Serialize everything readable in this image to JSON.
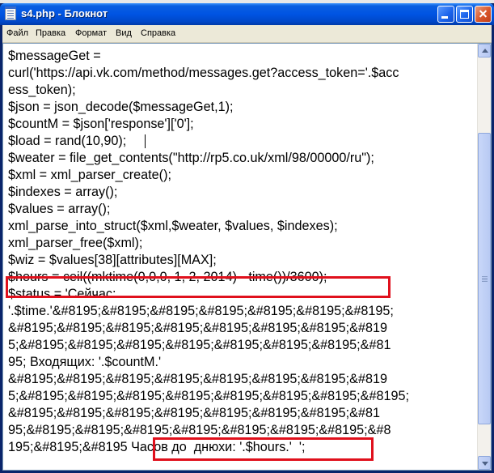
{
  "window": {
    "title": "s4.php - Блокнот"
  },
  "menu": [
    "Файл",
    "Правка",
    "Формат",
    "Вид",
    "Справка"
  ],
  "icons": {
    "app": "notepad-icon",
    "minimize": "minimize-icon",
    "maximize": "maximize-icon",
    "close": "close-icon",
    "scroll_up": "arrow-up-icon",
    "scroll_down": "arrow-down-icon"
  },
  "colors": {
    "highlight": "#e0101c",
    "titlebar": "#0054e3"
  },
  "editor": {
    "lines": [
      "$messageGet =",
      "curl('https://api.vk.com/method/messages.get?access_token='.$acc",
      "ess_token);",
      "$json = json_decode($messageGet,1);",
      "$countM = $json['response']['0'];",
      "$load = rand(10,90);",
      "$weater = file_get_contents(\"http://rp5.co.uk/xml/98/00000/ru\");",
      "$xml = xml_parser_create();",
      "$indexes = array();",
      "$values = array();",
      "xml_parse_into_struct($xml,$weater, $values, $indexes);",
      "xml_parser_free($xml);",
      "$wiz = $values[38][attributes][MAX];",
      "$hours = ceil((mktime(0,0,0, 1, 2, 2014) - time())/3600);",
      "$status = 'Сейчас:",
      "'.$time.'&#8195;&#8195;&#8195;&#8195;&#8195;&#8195;&#8195;",
      "&#8195;&#8195;&#8195;&#8195;&#8195;&#8195;&#8195;&#819",
      "5;&#8195;&#8195;&#8195;&#8195;&#8195;&#8195;&#8195;&#81",
      "95; Входящих: '.$countM.'",
      "&#8195;&#8195;&#8195;&#8195;&#8195;&#8195;&#8195;&#819",
      "5;&#8195;&#8195;&#8195;&#8195;&#8195;&#8195;&#8195;&#8195;",
      "&#8195;&#8195;&#8195;&#8195;&#8195;&#8195;&#8195;&#81",
      "95;&#8195;&#8195;&#8195;&#8195;&#8195;&#8195;&#8195;&#8",
      "195;&#8195;&#8195"
    ],
    "last_line_tail": " Часов до  днюхи: '.$hours.'  ';"
  }
}
